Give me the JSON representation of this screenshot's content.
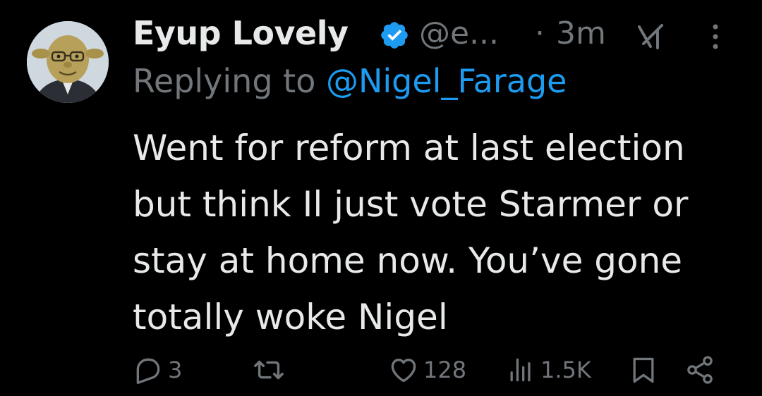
{
  "tweet": {
    "author": {
      "display_name": "Eyup Lovely",
      "handle": "@e...",
      "verified": true,
      "avatar_icon": "avatar-cartoon-face"
    },
    "separator": "·",
    "timestamp": "3m",
    "header_icons": [
      "grok-icon",
      "more-icon"
    ],
    "reply": {
      "prefix": "Replying to ",
      "mention": "@Nigel_Farage"
    },
    "text": "Went for reform at last election\nbut think Il just vote Starmer or\nstay at home now. You’ve gone\ntotally woke Nigel",
    "actions": {
      "reply": {
        "icon": "reply-icon",
        "count": "3"
      },
      "retweet": {
        "icon": "retweet-icon",
        "count": ""
      },
      "like": {
        "icon": "heart-icon",
        "count": "128"
      },
      "views": {
        "icon": "views-icon",
        "count": "1.5K"
      },
      "bookmark": {
        "icon": "bookmark-icon"
      },
      "share": {
        "icon": "share-icon"
      }
    }
  },
  "colors": {
    "background": "#000000",
    "text_primary": "#e7e9ea",
    "text_secondary": "#71767b",
    "accent": "#1d9bf0"
  }
}
